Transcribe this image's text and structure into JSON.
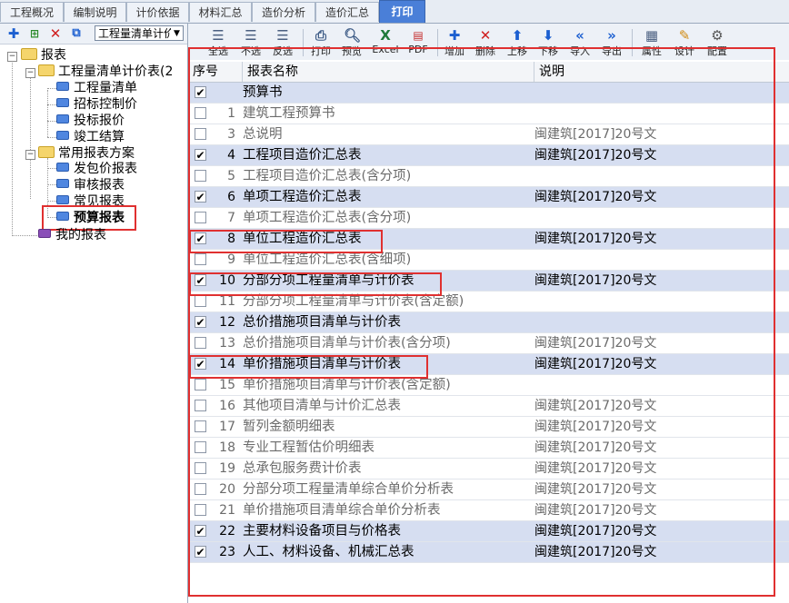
{
  "tabs": [
    "工程概况",
    "编制说明",
    "计价依据",
    "材料汇总",
    "造价分析",
    "造价汇总",
    "打印"
  ],
  "left_panel": {
    "toolbar_icons": [
      "add-icon",
      "add-child-icon",
      "delete-icon",
      "copy-icon"
    ],
    "report_set_select": "工程量清单计价",
    "tree": {
      "root": "报表",
      "group1": {
        "label": "工程量清单计价表(2",
        "children": [
          "工程量清单",
          "招标控制价",
          "投标报价",
          "竣工结算"
        ]
      },
      "group2": {
        "label": "常用报表方案",
        "children": [
          "发包价报表",
          "审核报表",
          "常见报表",
          "预算报表"
        ]
      },
      "my_reports": "我的报表"
    }
  },
  "toolbar": {
    "select_all": "全选",
    "select_none": "不选",
    "invert": "反选",
    "print": "打印",
    "preview": "预览",
    "excel": "Excel",
    "pdf": "PDF",
    "add": "增加",
    "delete": "删除",
    "move_up": "上移",
    "move_down": "下移",
    "import": "导入",
    "export": "导出",
    "properties": "属性",
    "design": "设计",
    "config": "配置"
  },
  "grid": {
    "headers": {
      "seq": "序号",
      "name": "报表名称",
      "note": "说明"
    },
    "rows": [
      {
        "checked": true,
        "num": "",
        "name": "预算书",
        "note": ""
      },
      {
        "checked": false,
        "num": "1",
        "name": "建筑工程预算书",
        "note": ""
      },
      {
        "checked": false,
        "num": "3",
        "name": "总说明",
        "note": "闽建筑[2017]20号文"
      },
      {
        "checked": true,
        "num": "4",
        "name": "工程项目造价汇总表",
        "note": "闽建筑[2017]20号文"
      },
      {
        "checked": false,
        "num": "5",
        "name": "工程项目造价汇总表(含分项)",
        "note": ""
      },
      {
        "checked": true,
        "num": "6",
        "name": "单项工程造价汇总表",
        "note": "闽建筑[2017]20号文"
      },
      {
        "checked": false,
        "num": "7",
        "name": "单项工程造价汇总表(含分项)",
        "note": ""
      },
      {
        "checked": true,
        "num": "8",
        "name": "单位工程造价汇总表",
        "note": "闽建筑[2017]20号文"
      },
      {
        "checked": false,
        "num": "9",
        "name": "单位工程造价汇总表(含细项)",
        "note": ""
      },
      {
        "checked": true,
        "num": "10",
        "name": "分部分项工程量清单与计价表",
        "note": "闽建筑[2017]20号文"
      },
      {
        "checked": false,
        "num": "11",
        "name": "分部分项工程量清单与计价表(含定额)",
        "note": ""
      },
      {
        "checked": true,
        "num": "12",
        "name": "总价措施项目清单与计价表",
        "note": ""
      },
      {
        "checked": false,
        "num": "13",
        "name": "总价措施项目清单与计价表(含分项)",
        "note": "闽建筑[2017]20号文"
      },
      {
        "checked": true,
        "num": "14",
        "name": "单价措施项目清单与计价表",
        "note": "闽建筑[2017]20号文"
      },
      {
        "checked": false,
        "num": "15",
        "name": "单价措施项目清单与计价表(含定额)",
        "note": ""
      },
      {
        "checked": false,
        "num": "16",
        "name": "其他项目清单与计价汇总表",
        "note": "闽建筑[2017]20号文"
      },
      {
        "checked": false,
        "num": "17",
        "name": "暂列金额明细表",
        "note": "闽建筑[2017]20号文"
      },
      {
        "checked": false,
        "num": "18",
        "name": "专业工程暂估价明细表",
        "note": "闽建筑[2017]20号文"
      },
      {
        "checked": false,
        "num": "19",
        "name": "总承包服务费计价表",
        "note": "闽建筑[2017]20号文"
      },
      {
        "checked": false,
        "num": "20",
        "name": "分部分项工程量清单综合单价分析表",
        "note": "闽建筑[2017]20号文"
      },
      {
        "checked": false,
        "num": "21",
        "name": "单价措施项目清单综合单价分析表",
        "note": "闽建筑[2017]20号文"
      },
      {
        "checked": true,
        "num": "22",
        "name": "主要材料设备项目与价格表",
        "note": "闽建筑[2017]20号文"
      },
      {
        "checked": true,
        "num": "23",
        "name": "人工、材料设备、机械汇总表",
        "note": "闽建筑[2017]20号文"
      }
    ]
  }
}
